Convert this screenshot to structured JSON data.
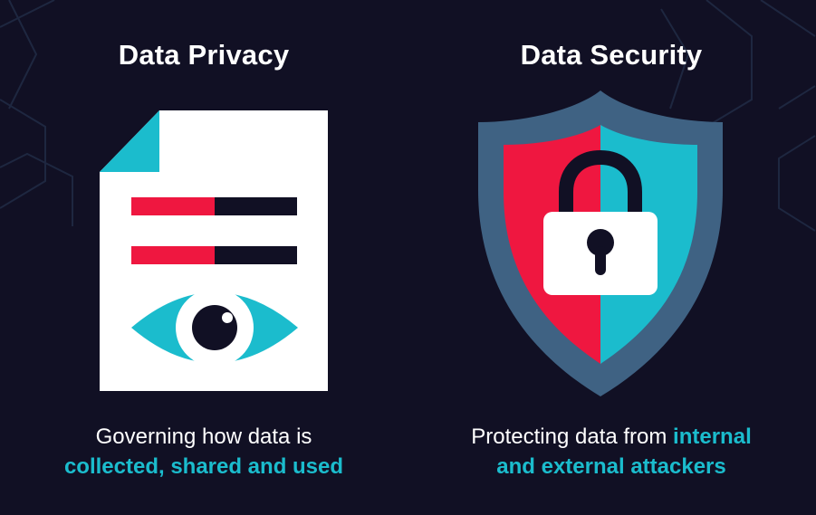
{
  "colors": {
    "background": "#111024",
    "accent_teal": "#1bbccd",
    "accent_red": "#ef1740",
    "navy": "#111024",
    "shield_rim": "#3f6283",
    "white": "#ffffff"
  },
  "privacy": {
    "title": "Data Privacy",
    "caption_line1": "Governing how data is",
    "caption_line2": "collected, shared and used",
    "icon": "document-eye-icon"
  },
  "security": {
    "title": "Data Security",
    "caption_part1": "Protecting data from ",
    "caption_highlight1": "internal",
    "caption_highlight2": "and external attackers",
    "icon": "shield-lock-icon"
  }
}
